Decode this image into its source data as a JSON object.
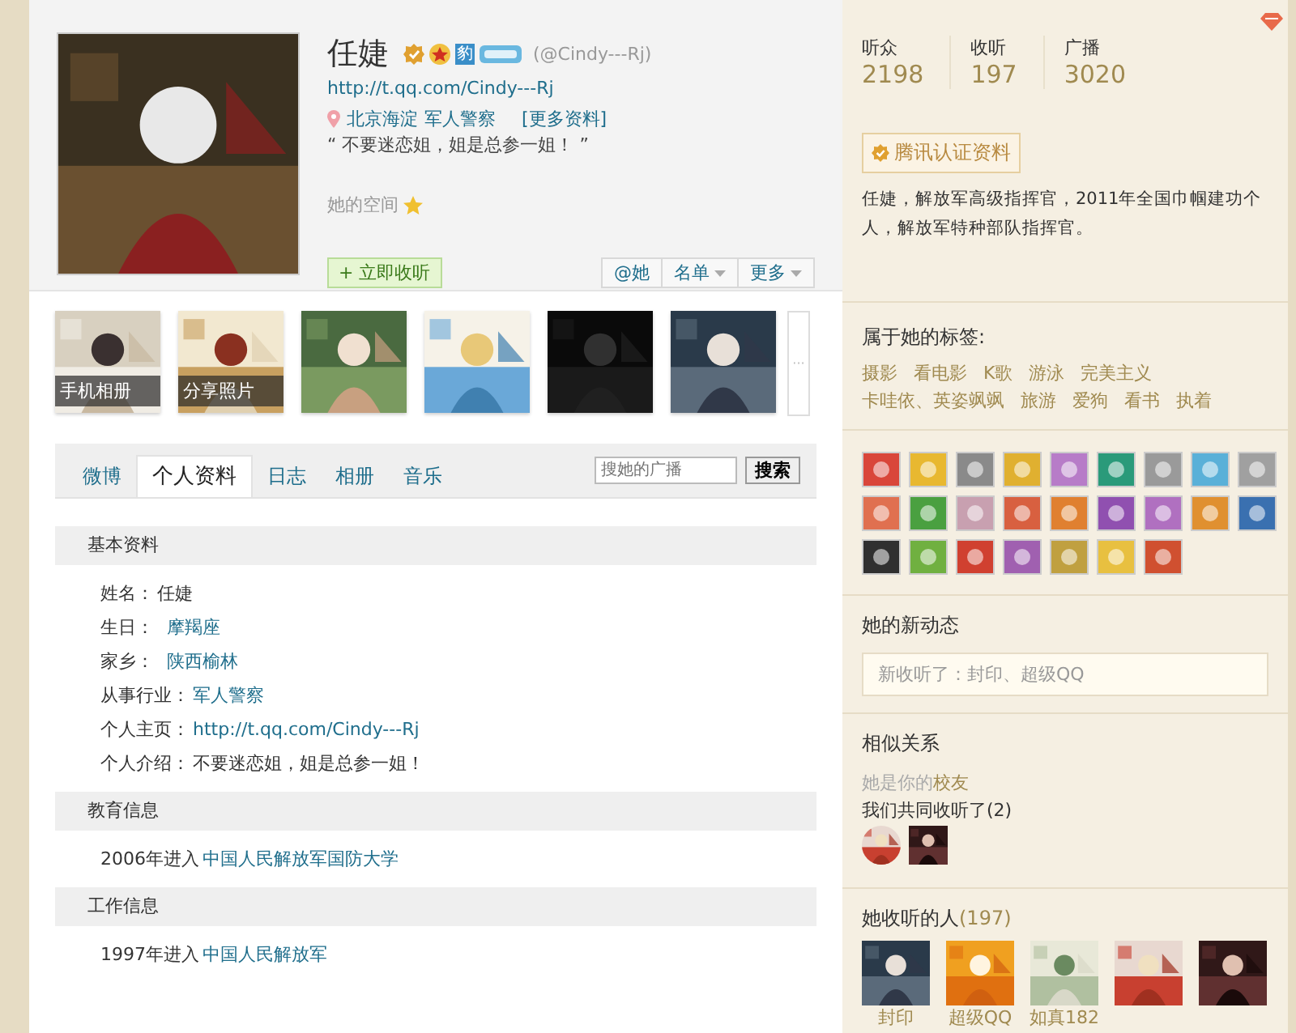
{
  "profile": {
    "name": "任婕",
    "level_badge": "豹",
    "handle": "(@Cindy---Rj)",
    "url": "http://t.qq.com/Cindy---Rj",
    "location": [
      "北京海淀",
      "军人警察"
    ],
    "more_link": "[更多资料]",
    "motto": "“ 不要迷恋姐，姐是总参一姐！ ”",
    "space_label": "她的空间",
    "follow_button": "+ 立即收听",
    "actions": [
      {
        "label": "@她",
        "dropdown": false
      },
      {
        "label": "名单",
        "dropdown": true
      },
      {
        "label": "更多",
        "dropdown": true
      }
    ]
  },
  "photos": [
    {
      "kind": "captioned",
      "caption": "手机相册"
    },
    {
      "kind": "captioned",
      "caption": "分享照片"
    },
    {
      "kind": "picture"
    },
    {
      "kind": "picture"
    },
    {
      "kind": "picture"
    },
    {
      "kind": "picture"
    }
  ],
  "photos_more": "···",
  "tabs": [
    {
      "label": "微博",
      "selected": false
    },
    {
      "label": "个人资料",
      "selected": true
    },
    {
      "label": "日志",
      "selected": false
    },
    {
      "label": "相册",
      "selected": false
    },
    {
      "label": "音乐",
      "selected": false
    }
  ],
  "search": {
    "placeholder": "搜她的广播",
    "button": "搜索"
  },
  "sections": [
    {
      "title": "基本资料",
      "rows": [
        {
          "label": "姓名：",
          "value": "任婕",
          "link": false
        },
        {
          "label": "生日：",
          "value": "摩羯座",
          "link": true
        },
        {
          "label": "家乡：",
          "value": "陕西榆林",
          "link": true
        },
        {
          "label": "从事行业：",
          "value": "军人警察",
          "link": true
        },
        {
          "label": "个人主页：",
          "value": "http://t.qq.com/Cindy---Rj",
          "link": true
        },
        {
          "label": "个人介绍：",
          "value": "不要迷恋姐，姐是总参一姐！",
          "link": false
        }
      ]
    },
    {
      "title": "教育信息",
      "rows": [
        {
          "label": "2006年进入",
          "value": "中国人民解放军国防大学",
          "link": true
        }
      ]
    },
    {
      "title": "工作信息",
      "rows": [
        {
          "label": "1997年进入",
          "value": "中国人民解放军",
          "link": true
        }
      ]
    }
  ],
  "sidebar": {
    "stats": [
      {
        "label": "听众",
        "value": "2198"
      },
      {
        "label": "收听",
        "value": "197"
      },
      {
        "label": "广播",
        "value": "3020"
      }
    ],
    "verify_button": "腾讯认证资料",
    "description": "任婕，解放军高级指挥官，2011年全国巾帼建功个人，解放军特种部队指挥官。",
    "tags_title": "属于她的标签:",
    "tags": [
      "摄影",
      "看电影",
      "K歌",
      "游泳",
      "完美主义",
      "卡哇依、英姿飒飒",
      "旅游",
      "爱狗",
      "看书",
      "执着"
    ],
    "badges": [
      {
        "color": "#d9463a"
      },
      {
        "color": "#e8b830"
      },
      {
        "color": "#8a8a8a"
      },
      {
        "color": "#e0b030"
      },
      {
        "color": "#b77cc8"
      },
      {
        "color": "#2a9a7a"
      },
      {
        "color": "#9a9a9a"
      },
      {
        "color": "#5ab0d8"
      },
      {
        "color": "#a0a0a0"
      },
      {
        "color": "#e07050"
      },
      {
        "color": "#4aa040"
      },
      {
        "color": "#c8a0b0"
      },
      {
        "color": "#d86040"
      },
      {
        "color": "#e08030"
      },
      {
        "color": "#9050b0"
      },
      {
        "color": "#b070c0"
      },
      {
        "color": "#e09030"
      },
      {
        "color": "#3a70b0"
      },
      {
        "color": "#303030"
      },
      {
        "color": "#70b040"
      },
      {
        "color": "#d04030"
      },
      {
        "color": "#a060b0"
      },
      {
        "color": "#c0a040"
      },
      {
        "color": "#e8c040"
      },
      {
        "color": "#d05030"
      }
    ],
    "news_title": "她的新动态",
    "news_text": "新收听了：封印、超级QQ",
    "similar_title": "相似关系",
    "alumni_prefix": "她是你的",
    "alumni_link": "校友",
    "common_label": "我们共同收听了",
    "common_count": "(2)",
    "common_people": [
      {
        "kind": "round"
      },
      {
        "kind": "square"
      }
    ],
    "following_title": "她收听的人",
    "following_count": "(197)",
    "following": [
      {
        "kind": "named",
        "name": "封印"
      },
      {
        "kind": "named",
        "name": "超级QQ"
      },
      {
        "kind": "named",
        "name": "如真182"
      },
      {
        "kind": "picture"
      },
      {
        "kind": "picture"
      }
    ]
  }
}
